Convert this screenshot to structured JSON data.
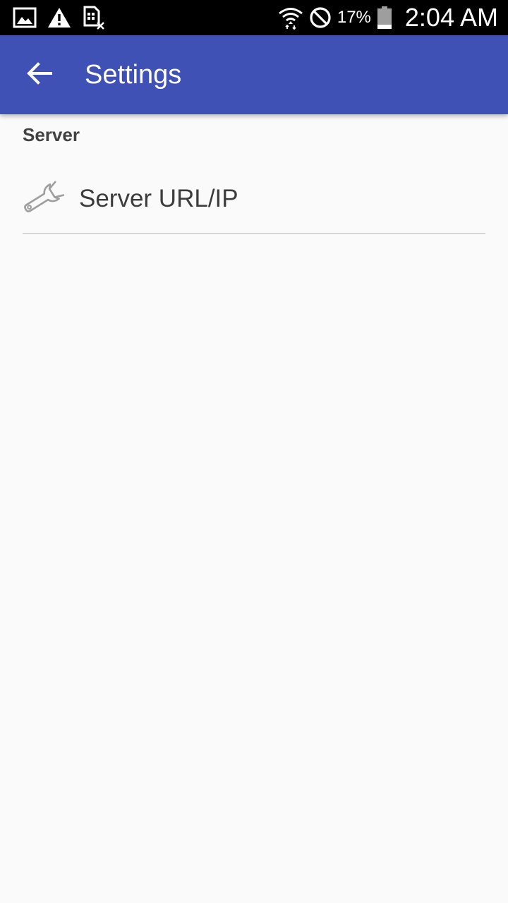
{
  "status_bar": {
    "left_icons": [
      "image-icon",
      "warning-icon",
      "sim-card-off-icon"
    ],
    "right_icons": [
      "wifi-icon",
      "do-not-disturb-icon",
      "battery-icon"
    ],
    "battery_percent": "17%",
    "time": "2:04 AM"
  },
  "app_bar": {
    "back_icon": "arrow-left-icon",
    "title": "Settings",
    "color": "#3f51b5"
  },
  "preferences": {
    "category_title": "Server",
    "items": [
      {
        "icon": "wrench-icon",
        "label": "Server URL/IP"
      }
    ]
  }
}
